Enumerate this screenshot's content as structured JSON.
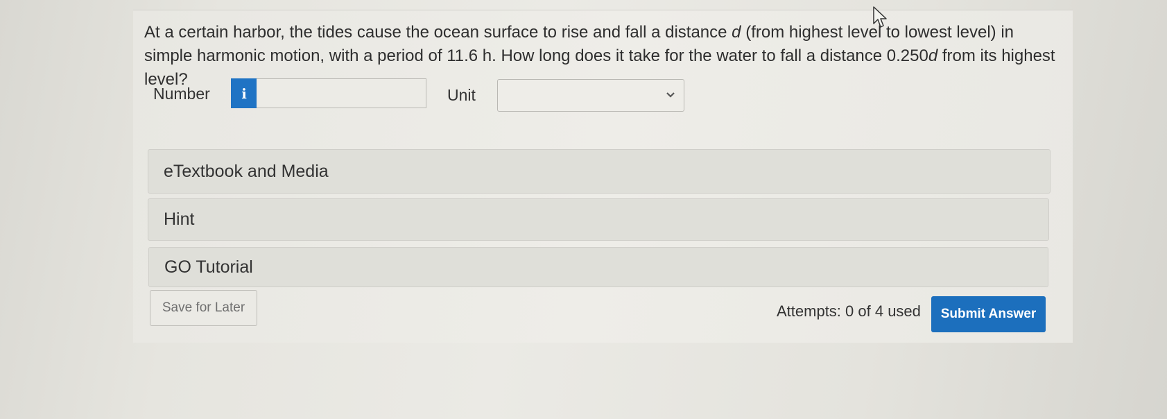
{
  "question": {
    "part1": "At a certain harbor, the tides cause the ocean surface to rise and fall a distance ",
    "var_d": "d",
    "part2": " (from highest level to lowest level) in simple harmonic motion, with a period of 11.6 h. How long does it take for the water to fall a distance 0.250",
    "var_d2": "d",
    "part3": " from its highest level?"
  },
  "answer": {
    "number_label": "Number",
    "info_icon": "info-icon",
    "info_glyph": "i",
    "number_value": "",
    "unit_label": "Unit",
    "unit_value": ""
  },
  "panels": {
    "etextbook": "eTextbook and Media",
    "hint": "Hint",
    "tutorial": "GO Tutorial"
  },
  "footer": {
    "save_label": "Save for Later",
    "attempts": "Attempts: 0 of 4 used",
    "submit_label": "Submit Answer"
  },
  "colors": {
    "accent": "#1f73c4",
    "panel_bg": "#dfdfd9"
  }
}
